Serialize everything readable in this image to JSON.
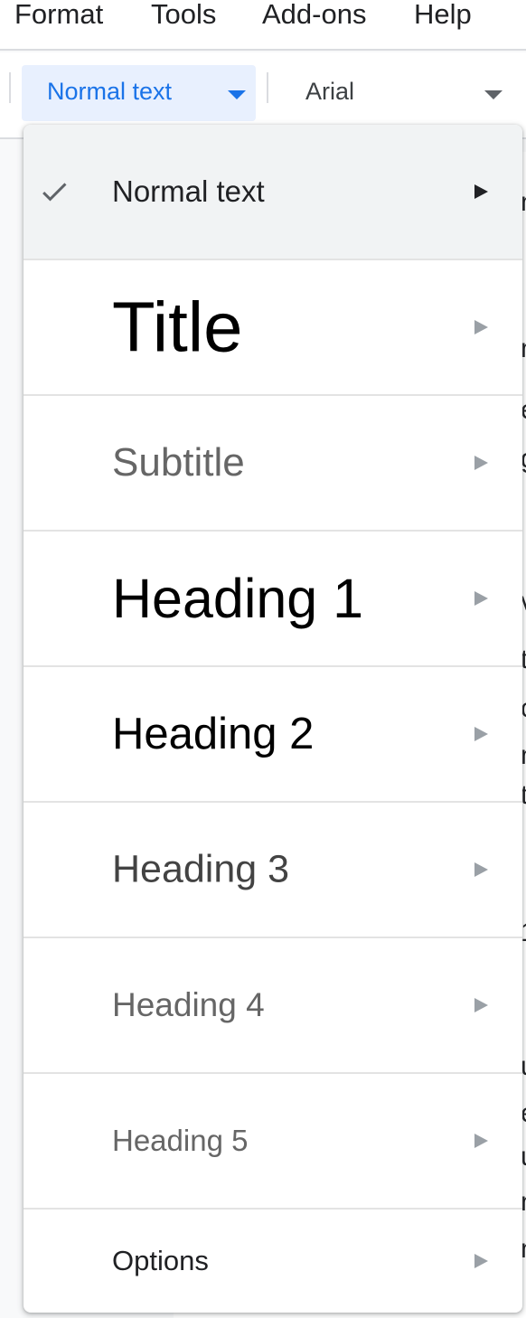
{
  "menubar": {
    "items": [
      "Format",
      "Tools",
      "Add-ons",
      "Help"
    ]
  },
  "toolbar": {
    "style_dropdown": {
      "value": "Normal text"
    },
    "font_dropdown": {
      "value": "Arial"
    }
  },
  "style_menu": {
    "selected": "Normal text",
    "items": [
      {
        "label": "Normal text"
      },
      {
        "label": "Title"
      },
      {
        "label": "Subtitle"
      },
      {
        "label": "Heading 1"
      },
      {
        "label": "Heading 2"
      },
      {
        "label": "Heading 3"
      },
      {
        "label": "Heading 4"
      },
      {
        "label": "Heading 5"
      },
      {
        "label": "Options"
      }
    ]
  },
  "document": {
    "fragments": [
      "n",
      "n",
      "e",
      "g",
      "v",
      "t",
      "c",
      "n",
      "t",
      "1",
      "u",
      "e",
      "u",
      "n",
      "n"
    ]
  },
  "colors": {
    "accent": "#1a73e8",
    "dropdown_active_bg": "#e8f0fe",
    "selected_row_bg": "#f1f3f4"
  }
}
